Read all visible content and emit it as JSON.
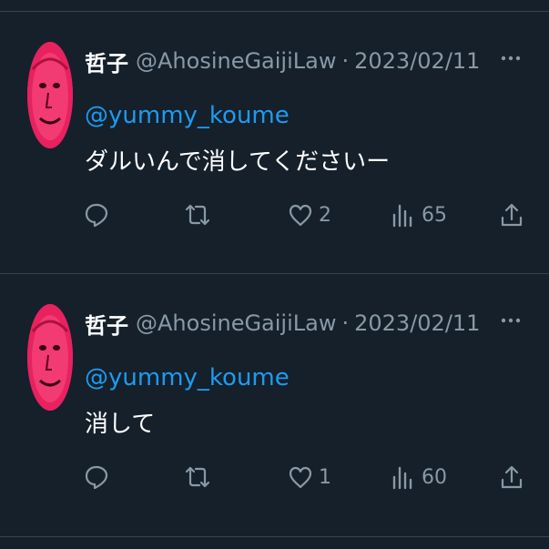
{
  "tweets": [
    {
      "author_name": "哲子",
      "handle": "@AhosineGaijiLaw",
      "separator": "·",
      "date": "2023/02/11",
      "reply_to": "@yummy_koume",
      "text": "ダルいんで消してくださいー",
      "actions": {
        "replies": "",
        "retweets": "",
        "likes": "2",
        "views": "65"
      },
      "icons": [
        "reply-icon",
        "retweet-icon",
        "like-icon",
        "views-icon",
        "share-icon",
        "more-icon"
      ]
    },
    {
      "author_name": "哲子",
      "handle": "@AhosineGaijiLaw",
      "separator": "·",
      "date": "2023/02/11",
      "reply_to": "@yummy_koume",
      "text": "消して",
      "actions": {
        "replies": "",
        "retweets": "",
        "likes": "1",
        "views": "60"
      },
      "icons": [
        "reply-icon",
        "retweet-icon",
        "like-icon",
        "views-icon",
        "share-icon",
        "more-icon"
      ]
    }
  ],
  "colors": {
    "background": "#15202b",
    "divider": "#38444d",
    "text_primary": "#ffffff",
    "text_secondary": "#8899a6",
    "link": "#1d9bf0",
    "avatar_bg": "#e8215f"
  }
}
